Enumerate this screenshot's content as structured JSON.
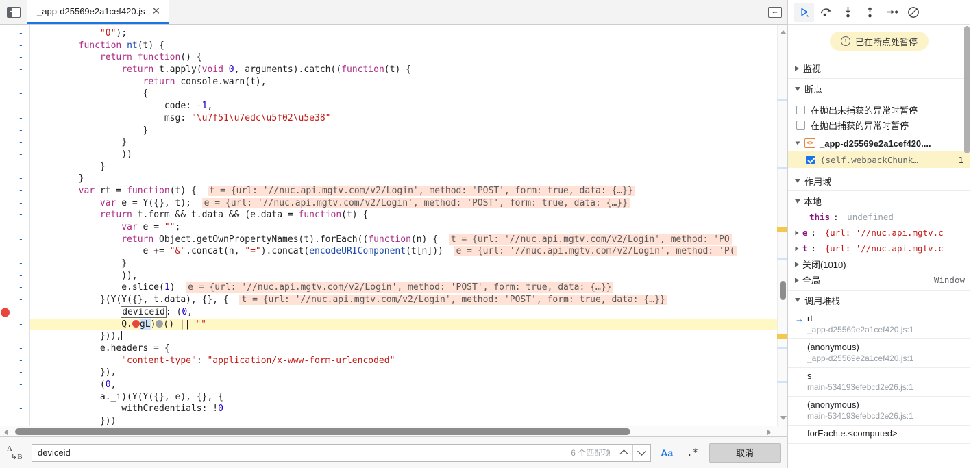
{
  "tabstrip": {
    "nav_toggle_icon": "show-navigator-icon",
    "tab_title": "_app-d25569e2a1cef420.js",
    "tab_close_icon": "close-icon",
    "right_panel_toggle_icon": "collapse-sidebar-icon"
  },
  "code": {
    "gutter_marker": "-",
    "lines": [
      {
        "text": "            \"0\");"
      },
      {
        "text": "        function nt(t) {"
      },
      {
        "text": "            return function() {"
      },
      {
        "text": "                return t.apply(void 0, arguments).catch((function(t) {"
      },
      {
        "text": "                    return console.warn(t),"
      },
      {
        "text": "                    {"
      },
      {
        "text": "                        code: -1,"
      },
      {
        "text": "                        msg: \"\\u7f51\\u7edc\\u5f02\\u5e38\""
      },
      {
        "text": "                    }"
      },
      {
        "text": "                }"
      },
      {
        "text": "                ))"
      },
      {
        "text": "            }"
      },
      {
        "text": "        }"
      },
      {
        "text": "        var rt = function(t) {",
        "inline": "t = {url: '//nuc.api.mgtv.com/v2/Login', method: 'POST', form: true, data: {…}}"
      },
      {
        "text": "            var e = Y({}, t);",
        "inline": "e = {url: '//nuc.api.mgtv.com/v2/Login', method: 'POST', form: true, data: {…}}"
      },
      {
        "text": "            return t.form && t.data && (e.data = function(t) {"
      },
      {
        "text": "                var e = \"\";"
      },
      {
        "text": "                return Object.getOwnPropertyNames(t).forEach((function(n) {",
        "inline": "t = {url: '//nuc.api.mgtv.com/v2/Login', method: 'PO"
      },
      {
        "text": "                    e += \"&\".concat(n, \"=\").concat(encodeURIComponent(t[n]))",
        "inline": "e = {url: '//nuc.api.mgtv.com/v2/Login', method: 'P("
      },
      {
        "text": "                }"
      },
      {
        "text": "                )),"
      },
      {
        "text": "                e.slice(1)",
        "inline": "e = {url: '//nuc.api.mgtv.com/v2/Login', method: 'POST', form: true, data: {…}}"
      },
      {
        "text": "            }(Y(Y({}, t.data), {}, {",
        "inline": "t = {url: '//nuc.api.mgtv.com/v2/Login', method: 'POST', form: true, data: {…}}"
      },
      {
        "text": "                deviceid: (0,"
      },
      {
        "text": "                Q.gL)() || \"\"",
        "executing": true
      },
      {
        "text": "            })),",
        "caret": true
      },
      {
        "text": "            e.headers = {"
      },
      {
        "text": "                \"content-type\": \"application/x-www-form-urlencoded\""
      },
      {
        "text": "            }),"
      },
      {
        "text": "            (0,"
      },
      {
        "text": "            a._i)(Y(Y({}, e), {}, {"
      },
      {
        "text": "                withCredentials: !0"
      },
      {
        "text": "            }))"
      }
    ],
    "selection_token": "deviceid",
    "highlight_token": "gL",
    "breakpoint_line_index": 23
  },
  "search": {
    "icon": "case-sensitive-ab-icon",
    "value": "deviceid",
    "placeholder": "",
    "match_count": "6 个匹配项",
    "prev_icon": "chevron-up-icon",
    "next_icon": "chevron-down-icon",
    "case_label": "Aa",
    "regex_label": ".*",
    "cancel_label": "取消"
  },
  "debugger": {
    "toolbar": [
      {
        "name": "resume-button",
        "icon": "resume-script-icon",
        "active": true
      },
      {
        "name": "step-over-button",
        "icon": "step-over-icon",
        "active": false
      },
      {
        "name": "step-into-button",
        "icon": "step-into-icon",
        "active": false
      },
      {
        "name": "step-out-button",
        "icon": "step-out-icon",
        "active": false
      },
      {
        "name": "step-button",
        "icon": "step-icon",
        "active": false
      },
      {
        "name": "deactivate-breakpoints-button",
        "icon": "deactivate-breakpoints-icon",
        "active": false
      }
    ],
    "pause_banner": "已在断点处暂停",
    "pause_banner_color": "#fdf3c8",
    "watch_section": "监视",
    "breakpoints_section": "断点",
    "pause_uncaught_label": "在抛出未捕获的异常时暂停",
    "pause_uncaught_checked": false,
    "pause_caught_label": "在抛出捕获的异常时暂停",
    "pause_caught_checked": false,
    "breakpoint_file": "_app-d25569e2a1cef420....",
    "breakpoint_entry": "(self.webpackChunk…",
    "breakpoint_entry_num": "1",
    "breakpoint_entry_checked": true,
    "scope_section": "作用域",
    "scope": [
      {
        "kind": "group",
        "label": "本地",
        "expanded": true
      },
      {
        "kind": "prop",
        "name": "this",
        "value": "undefined",
        "style": "undefined"
      },
      {
        "kind": "expandable",
        "name": "e",
        "value": "{url: '//nuc.api.mgtv.c"
      },
      {
        "kind": "expandable",
        "name": "t",
        "value": "{url: '//nuc.api.mgtv.c"
      },
      {
        "kind": "group",
        "label": "关闭(1010)",
        "expanded": false
      },
      {
        "kind": "group",
        "label": "全局",
        "expanded": false,
        "right": "Window"
      }
    ],
    "callstack_section": "调用堆栈",
    "callstack": [
      {
        "fn": "rt",
        "loc": "_app-d25569e2a1cef420.js:1",
        "current": true
      },
      {
        "fn": "(anonymous)",
        "loc": "_app-d25569e2a1cef420.js:1",
        "current": false
      },
      {
        "fn": "s",
        "loc": "main-534193efebcd2e26.js:1",
        "current": false
      },
      {
        "fn": "(anonymous)",
        "loc": "main-534193efebcd2e26.js:1",
        "current": false
      },
      {
        "fn": "forEach.e.<computed>",
        "loc": "",
        "current": false
      }
    ]
  }
}
